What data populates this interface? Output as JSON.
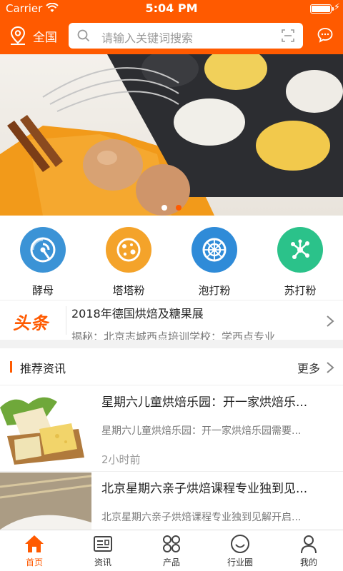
{
  "status_bar": {
    "carrier": "Carrier",
    "time": "5:04 PM"
  },
  "header": {
    "location": "全国",
    "search_placeholder": "请输入关键词搜索"
  },
  "banner": {
    "slide_count": 2,
    "active_slide": 2
  },
  "categories": [
    {
      "label": "酵母",
      "icon": "radar-icon",
      "color": "#3b93d6"
    },
    {
      "label": "塔塔粉",
      "icon": "bubbles-icon",
      "color": "#f4a32a"
    },
    {
      "label": "泡打粉",
      "icon": "wheel-icon",
      "color": "#2f8bd8"
    },
    {
      "label": "苏打粉",
      "icon": "molecule-icon",
      "color": "#2bc28a"
    }
  ],
  "headline": {
    "tag": "头条",
    "line1": "2018年德国烘焙及糖果展",
    "line2": "揭秘：北京志城西点培训学校：学西点专业"
  },
  "section": {
    "title": "推荐资讯",
    "more": "更多"
  },
  "articles": [
    {
      "title": "星期六儿童烘焙乐园：开一家烘焙乐...",
      "desc": "星期六儿童烘焙乐园：开一家烘焙乐园需要...",
      "time": "2小时前"
    },
    {
      "title": "北京星期六亲子烘焙课程专业独到见...",
      "desc": "北京星期六亲子烘焙课程专业独到见解开启...",
      "time": ""
    }
  ],
  "tabs": [
    {
      "label": "首页",
      "icon": "home-icon",
      "active": true
    },
    {
      "label": "资讯",
      "icon": "news-icon",
      "active": false
    },
    {
      "label": "产品",
      "icon": "grid-icon",
      "active": false
    },
    {
      "label": "行业圈",
      "icon": "smile-icon",
      "active": false
    },
    {
      "label": "我的",
      "icon": "user-icon",
      "active": false
    }
  ],
  "colors": {
    "accent": "#ff5a00"
  }
}
